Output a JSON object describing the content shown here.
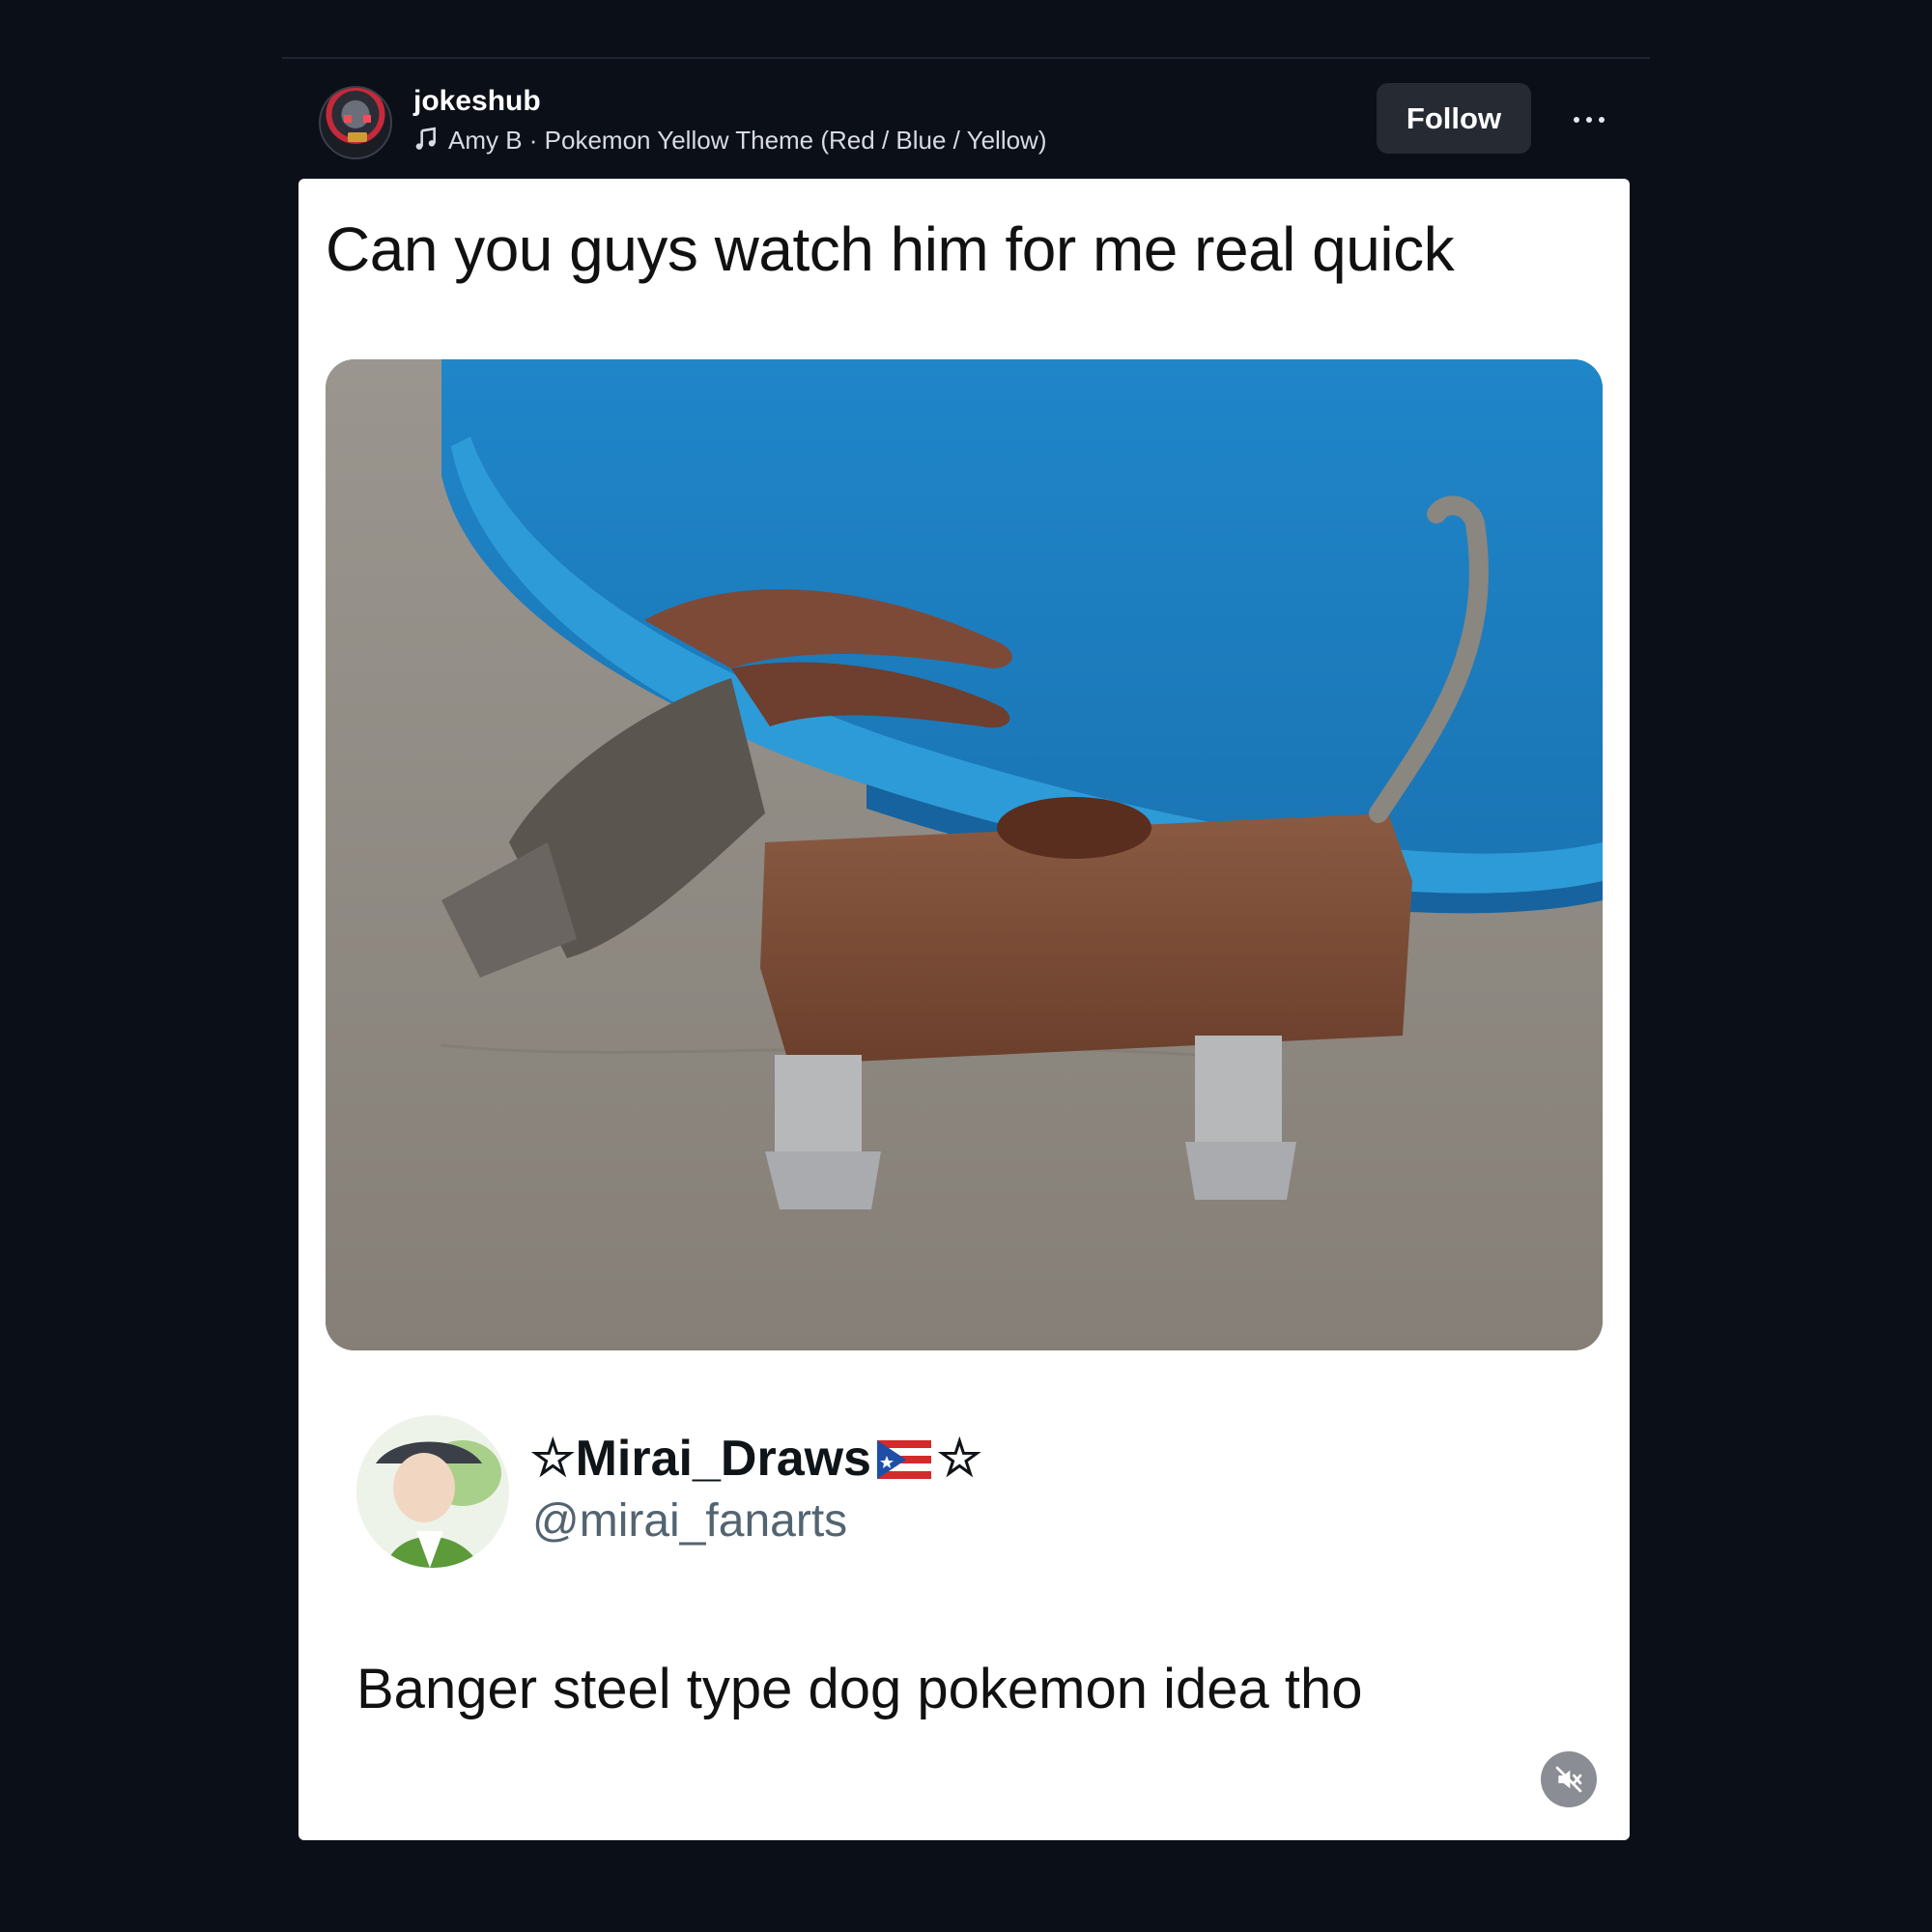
{
  "header": {
    "username": "jokeshub",
    "music_icon": "music-note-icon",
    "music": "Amy B · Pokemon Yellow Theme (Red / Blue / Yellow)",
    "follow_label": "Follow",
    "more_icon": "more-horizontal-icon"
  },
  "post": {
    "caption": "Can you guys watch him for me real quick",
    "tweet": {
      "name": "☆Mirai_Draws",
      "name_suffix": "☆",
      "flag_icon": "puerto-rico-flag-icon",
      "handle": "@mirai_fanarts",
      "text": "Banger steel type dog pokemon idea tho"
    },
    "mute_icon": "speaker-muted-icon"
  },
  "colors": {
    "background": "#0b0f18",
    "follow_button": "#262b33",
    "card": "#ffffff",
    "handle": "#536471"
  }
}
